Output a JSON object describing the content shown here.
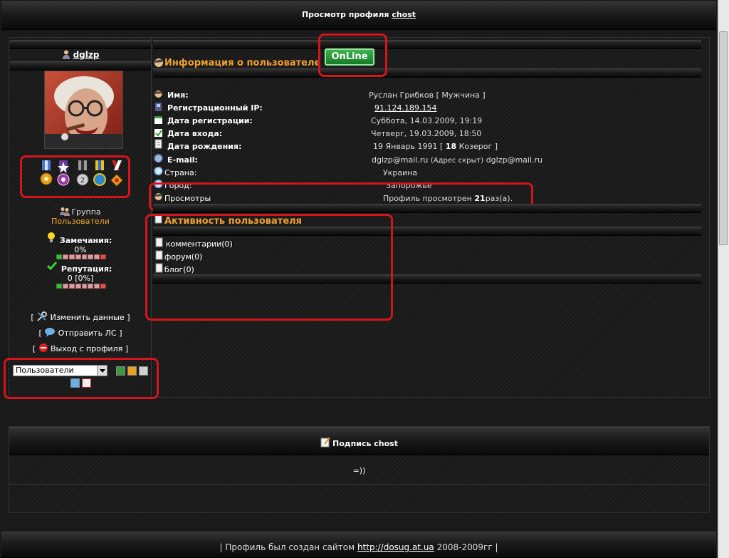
{
  "header": {
    "title_prefix": "Просмотр профиля",
    "profile_name": "chost"
  },
  "left": {
    "username": "dglzp",
    "group_label": "Группа",
    "group_value": "Пользователи",
    "warnings_label": "Замечания:",
    "warnings_value": "0%",
    "warnings_percent": 0,
    "reputation_label": "Репутация:",
    "reputation_value": "0 [0%]",
    "reputation_percent": 0,
    "edit_link": "Изменить данные",
    "pm_link": "Отправить ЛС",
    "logout_link": "Выход с профиля",
    "select_value": "Пользователи",
    "bracket_open": "[",
    "bracket_close": "]"
  },
  "main": {
    "online_label": "OnLine",
    "info_title": "Информация о пользователе",
    "fields": [
      {
        "label": "Имя:",
        "value": "Руслан Грибков [ Мужчина ]"
      },
      {
        "label": "Регистрационный IP:",
        "value": "91.124.189.154"
      },
      {
        "label": "Дата регистрации:",
        "value": "Суббота, 14.03.2009, 19:19"
      },
      {
        "label": "Дата входа:",
        "value": "Четверг, 19.03.2009, 18:50"
      },
      {
        "label": "Дата рождения:",
        "value_pre": "19 Январь 1991 [ ",
        "value_age": "18",
        "value_post": " Козерог ]"
      },
      {
        "label": "E-mail:",
        "value_pre": "dglzp@mail.ru",
        "value_hidden": "(Адрес скрыт)",
        "value_post": "dglzp@mail.ru"
      },
      {
        "label": "Страна:",
        "value": "Украина"
      },
      {
        "label": "Город:",
        "value": "Запорожье"
      },
      {
        "label": "Просмотры",
        "value_pre": "Профиль просмотрен ",
        "value_count": "21",
        "value_post": "раз(а)."
      }
    ],
    "activity_title": "Активность пользователя",
    "activity": [
      {
        "label": "комментарии(0)"
      },
      {
        "label": "форум(0)"
      },
      {
        "label": "блог(0)"
      }
    ]
  },
  "signature": {
    "title": "Подпись chost",
    "text": "=))"
  },
  "footer": {
    "pre": "| Профиль был создан сайтом",
    "link": "http://dosug.at.ua",
    "post": "2008-2009гг |"
  },
  "colors": {
    "accent_orange": "#f0a030",
    "highlight_red": "#d4151b",
    "online_green": "#2a9a3a"
  }
}
